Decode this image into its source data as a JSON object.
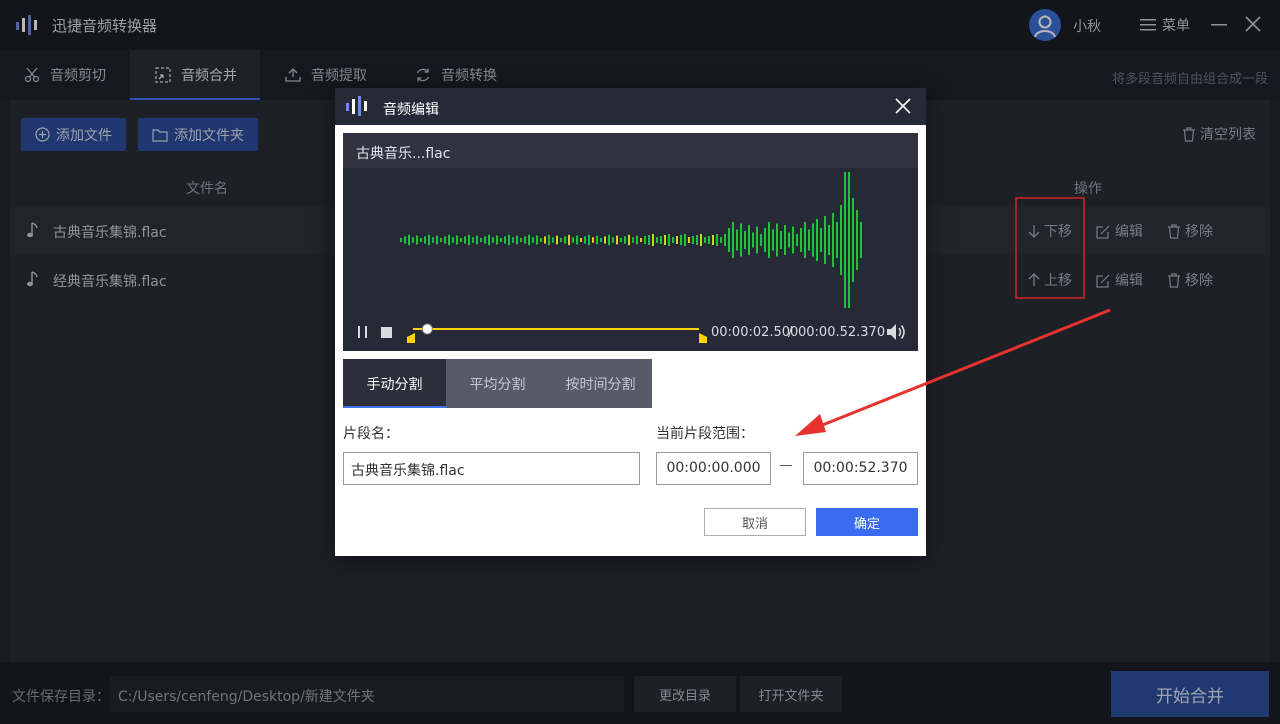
{
  "app": {
    "title": "迅捷音频转换器",
    "username": "小秋",
    "menu_label": "菜单"
  },
  "tabs": [
    {
      "label": "音频剪切",
      "icon": "scissors-icon",
      "active": false
    },
    {
      "label": "音频合并",
      "icon": "merge-icon",
      "active": true
    },
    {
      "label": "音频提取",
      "icon": "upload-icon",
      "active": false
    },
    {
      "label": "音频转换",
      "icon": "refresh-icon",
      "active": false
    }
  ],
  "tab_hint": "将多段音频自由组合成一段",
  "toolbar": {
    "add_file": "添加文件",
    "add_folder": "添加文件夹",
    "clear_list": "清空列表"
  },
  "table": {
    "col_filename": "文件名",
    "col_actions": "操作",
    "rows": [
      {
        "name": "古典音乐集锦.flac",
        "move": "下移",
        "edit": "编辑",
        "remove": "移除"
      },
      {
        "name": "经典音乐集锦.flac",
        "move": "上移",
        "edit": "编辑",
        "remove": "移除"
      }
    ]
  },
  "footer": {
    "save_label": "文件保存目录：",
    "save_path": "C:/Users/cenfeng/Desktop/新建文件夹",
    "change_dir": "更改目录",
    "open_folder": "打开文件夹",
    "start": "开始合并"
  },
  "dialog": {
    "title": "音频编辑",
    "player": {
      "file_name": "古典音乐...flac",
      "current_time": "00:00:02.500",
      "separator": "/",
      "total_time": "00:00.52.370",
      "progress": 0.05
    },
    "split_tabs": [
      "手动分割",
      "平均分割",
      "按时间分割"
    ],
    "segment_name_label": "片段名：",
    "segment_name_value": "古典音乐集锦.flac",
    "range_label": "当前片段范围：",
    "range_start": "00:00:00.000",
    "range_end": "00:00:52.370",
    "cancel": "取消",
    "confirm": "确定"
  },
  "colors": {
    "accent": "#3f72f2",
    "highlight": "#e8322d",
    "wave_green": "#22c13a",
    "wave_yellow": "#d7d21a",
    "timeline_yellow": "#ffd400"
  }
}
